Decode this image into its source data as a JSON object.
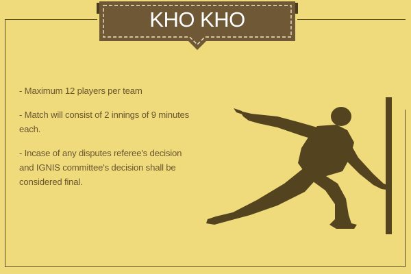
{
  "banner": {
    "title": "KHO KHO"
  },
  "rules": [
    "- Maximum 12 players per team",
    "- Match will consist of 2 innings of 9 minutes each.",
    "- Incase of any disputes referee's decision and IGNIS committee's decision shall be considered final."
  ],
  "colors": {
    "background": "#f0db7c",
    "banner": "#6f5836",
    "silhouette": "#53441f",
    "text": "#6a5630"
  },
  "illustration": {
    "player": "kho-kho-player-silhouette",
    "post": "pole"
  }
}
